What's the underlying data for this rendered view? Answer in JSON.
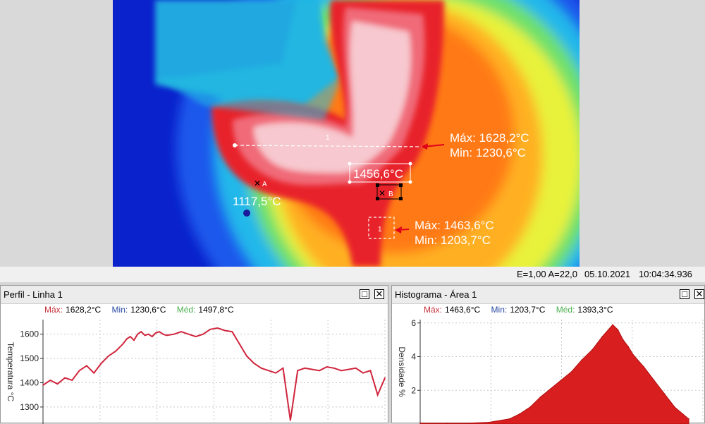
{
  "thermal": {
    "line_label": "1",
    "line_max": "Máx: 1628,2°C",
    "line_min": "Min:  1230,6°C",
    "center_temp": "1456,6°C",
    "point_a_label": "A",
    "point_a_temp": "1117,5°C",
    "point_b_label": "B",
    "area_label": "1",
    "area_max": "Máx: 1463,6°C",
    "area_min": "Min:  1203,7°C"
  },
  "status": {
    "params": "E=1,00 A=22,0",
    "date": "05.10.2021",
    "time": "10:04:34.936"
  },
  "profile_panel": {
    "title": "Perfil - Linha 1",
    "max_key": "Máx:",
    "max_val": "1628,2°C",
    "min_key": "Min:",
    "min_val": "1230,6°C",
    "med_key": "Méd:",
    "med_val": "1497,8°C",
    "maximize_label": "□",
    "close_label": "✕"
  },
  "histogram_panel": {
    "title": "Histograma - Área 1",
    "max_key": "Máx:",
    "max_val": "1463,6°C",
    "min_key": "Min:",
    "min_val": "1203,7°C",
    "med_key": "Méd:",
    "med_val": "1393,3°C",
    "maximize_label": "□",
    "close_label": "✕"
  },
  "colors": {
    "line_color": "#d0243c",
    "hist_fill": "#d81e1e",
    "max_key": "#c8323c",
    "min_key": "#2a4aa0",
    "med_key": "#4caf50"
  },
  "chart_data": [
    {
      "type": "line",
      "title": "",
      "ylabel": "Temperatura °C",
      "xlabel": "",
      "ylim": [
        1230,
        1660
      ],
      "yticks": [
        "1600",
        "1500",
        "1400",
        "1300"
      ],
      "x": [
        0,
        10,
        20,
        30,
        40,
        50,
        60,
        70,
        80,
        90,
        100,
        110,
        115,
        120,
        125,
        130,
        135,
        140,
        145,
        150,
        155,
        160,
        165,
        170,
        180,
        190,
        200,
        210,
        220,
        230,
        240,
        250,
        260,
        270,
        280,
        290,
        300,
        310,
        320,
        330,
        340,
        350,
        360,
        370,
        380,
        390,
        400,
        410,
        420,
        430,
        440,
        450,
        460,
        470
      ],
      "values": [
        1390,
        1410,
        1395,
        1420,
        1410,
        1450,
        1470,
        1440,
        1480,
        1510,
        1530,
        1560,
        1580,
        1590,
        1575,
        1600,
        1610,
        1595,
        1600,
        1590,
        1605,
        1610,
        1600,
        1595,
        1600,
        1610,
        1600,
        1590,
        1600,
        1620,
        1625,
        1615,
        1610,
        1560,
        1510,
        1480,
        1460,
        1450,
        1440,
        1460,
        1245,
        1450,
        1460,
        1455,
        1450,
        1465,
        1460,
        1450,
        1455,
        1460,
        1440,
        1450,
        1350,
        1420
      ]
    },
    {
      "type": "area",
      "title": "",
      "ylabel": "Densidade %",
      "xlabel": "",
      "ylim": [
        0,
        6.2
      ],
      "yticks": [
        "6",
        "4",
        "2"
      ],
      "x": [
        1203.7,
        1230,
        1250,
        1270,
        1290,
        1300,
        1310,
        1320,
        1330,
        1340,
        1350,
        1360,
        1370,
        1380,
        1390,
        1395,
        1400,
        1405,
        1410,
        1420,
        1430,
        1440,
        1450,
        1463.6
      ],
      "values": [
        0.05,
        0.05,
        0.05,
        0.1,
        0.3,
        0.6,
        1.0,
        1.6,
        2.1,
        2.6,
        3.1,
        3.8,
        4.4,
        5.2,
        5.9,
        5.6,
        5.0,
        4.6,
        4.1,
        3.4,
        2.6,
        1.8,
        1.0,
        0.3
      ]
    }
  ]
}
